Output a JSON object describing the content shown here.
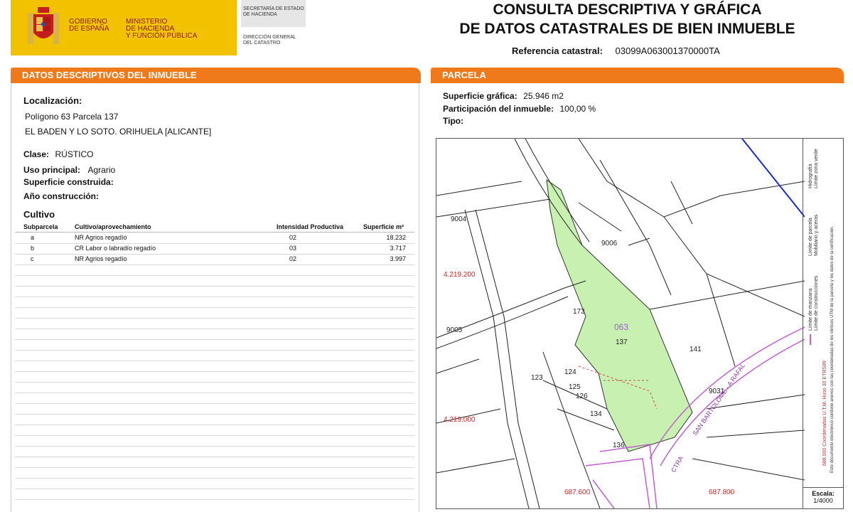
{
  "header": {
    "gov_line1": "GOBIERNO",
    "gov_line2": "DE ESPAÑA",
    "min_line1": "MINISTERIO",
    "min_line2": "DE HACIENDA",
    "min_line3": "Y FUNCIÓN PÚBLICA",
    "sec_line1": "SECRETARÍA DE ESTADO",
    "sec_line2": "DE HACIENDA",
    "dir_line1": "DIRECCIÓN GENERAL",
    "dir_line2": "DEL CATASTRO",
    "title_line1": "CONSULTA DESCRIPTIVA Y GRÁFICA",
    "title_line2": "DE DATOS CATASTRALES DE BIEN INMUEBLE",
    "ref_label": "Referencia catastral:",
    "ref_value": "03099A063001370000TA"
  },
  "left": {
    "section_title": "DATOS DESCRIPTIVOS DEL INMUEBLE",
    "localizacion_label": "Localización:",
    "loc_line1": "Polígono 63 Parcela 137",
    "loc_line2": "EL BADEN Y LO SOTO. ORIHUELA [ALICANTE]",
    "clase_label": "Clase:",
    "clase_value": "RÚSTICO",
    "uso_label": "Uso principal:",
    "uso_value": "Agrario",
    "sup_const_label": "Superficie construida:",
    "anio_label": "Año construcción:",
    "cultivo_title": "Cultivo",
    "columns": [
      "Subparcela",
      "Cultivo/aprovechamiento",
      "Intensidad Productiva",
      "Superficie m²"
    ],
    "rows": [
      [
        "a",
        "NR Agrios regadío",
        "02",
        "18.232"
      ],
      [
        "b",
        "CR Labor o labradío regadío",
        "03",
        "3.717"
      ],
      [
        "c",
        "NR Agrios regadío",
        "02",
        "3.997"
      ]
    ]
  },
  "right": {
    "section_title": "PARCELA",
    "sup_grafica_label": "Superficie gráfica:",
    "sup_grafica_value": "25.946 m2",
    "particip_label": "Participación del inmueble:",
    "particip_value": "100,00 %",
    "tipo_label": "Tipo:"
  },
  "map": {
    "labels": {
      "l9004": "9004",
      "l9006": "9006",
      "l9005": "9005",
      "l173": "173",
      "l063": "063",
      "l137": "137",
      "l141": "141",
      "l123": "123",
      "l124": "124",
      "l125": "125",
      "l126": "126",
      "l134": "134",
      "l136": "136",
      "l9031": "9031",
      "coordA": "4.219.200",
      "coordB": "4.219.000",
      "coordC": "687.600",
      "coordD": "687.800",
      "street": "SAN BARTOLOME - A RAFAL",
      "ctra": "CTRA"
    },
    "legend": {
      "line1": "Límite de manzana",
      "line2": "Límite de parcela",
      "line3": "Límite de construcciones",
      "line4": "Mobiliario y aceras",
      "line5": "Límite zona verde",
      "line6": "Hidrografía",
      "coords": "688.000 Coordenadas U.T.M. Huso 30 ETRS89",
      "note": "Este documento electrónico contiene anexos con las coordenadas de los vértices UTM de la parcela y los datos de la certificación."
    },
    "scale_label": "Escala:",
    "scale_value": "1/4000"
  },
  "colors": {
    "orange": "#f07a1a",
    "yellow": "#f2c200",
    "parcel_green": "#c8f0b0",
    "boundary_pink": "#c060d0",
    "coord_red": "#cc2a2a"
  }
}
